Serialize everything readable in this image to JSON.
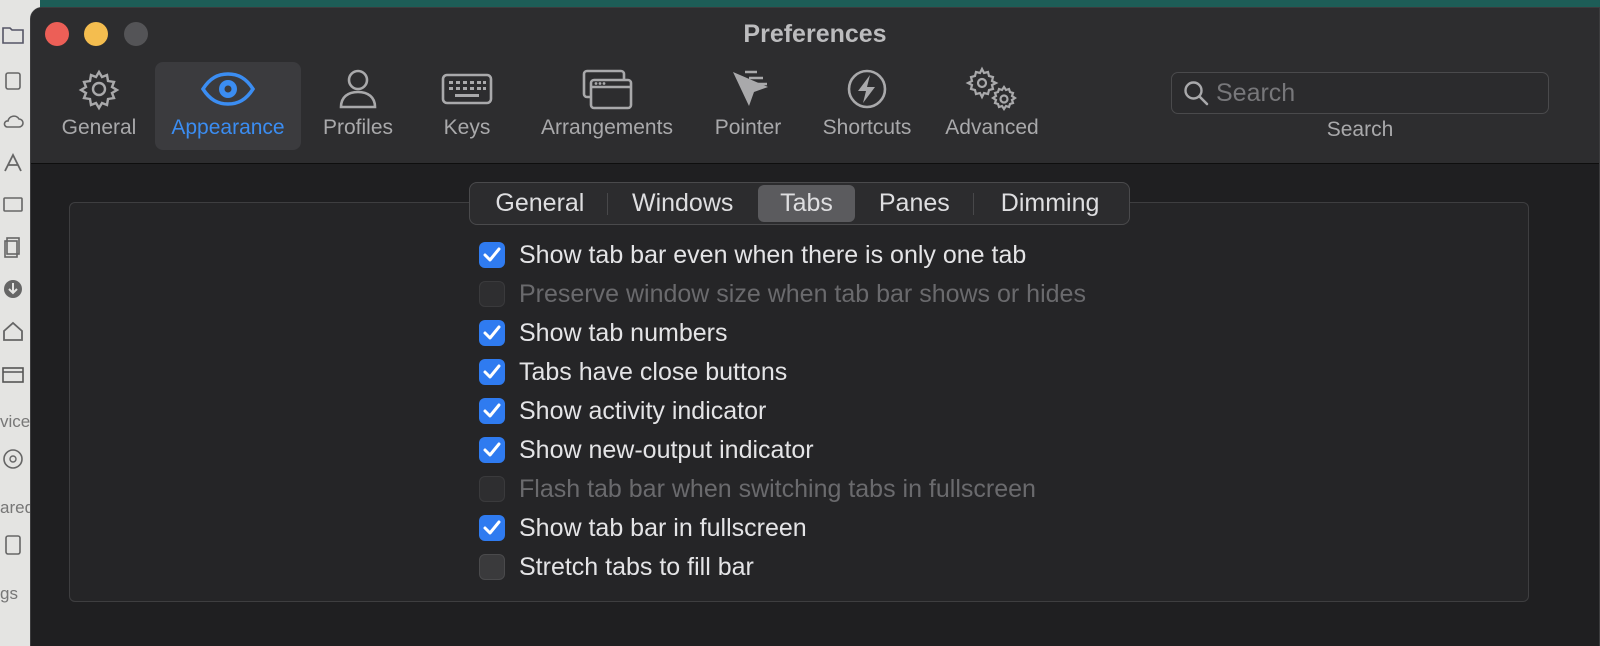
{
  "window": {
    "title": "Preferences"
  },
  "background": {
    "partial_texts": [
      "vice",
      "ared",
      "gs"
    ]
  },
  "toolbar": {
    "items": [
      {
        "label": "General",
        "icon": "gear-icon",
        "active": false
      },
      {
        "label": "Appearance",
        "icon": "eye-icon",
        "active": true
      },
      {
        "label": "Profiles",
        "icon": "person-icon",
        "active": false
      },
      {
        "label": "Keys",
        "icon": "keyboard-icon",
        "active": false
      },
      {
        "label": "Arrangements",
        "icon": "windows-icon",
        "active": false
      },
      {
        "label": "Pointer",
        "icon": "pointer-icon",
        "active": false
      },
      {
        "label": "Shortcuts",
        "icon": "lightning-icon",
        "active": false
      },
      {
        "label": "Advanced",
        "icon": "gears-icon",
        "active": false
      }
    ],
    "search": {
      "placeholder": "Search",
      "label": "Search"
    }
  },
  "subtabs": {
    "items": [
      "General",
      "Windows",
      "Tabs",
      "Panes",
      "Dimming"
    ],
    "selected": "Tabs"
  },
  "options": [
    {
      "label": "Show tab bar even when there is only one tab",
      "checked": true,
      "enabled": true
    },
    {
      "label": "Preserve window size when tab bar shows or hides",
      "checked": false,
      "enabled": false
    },
    {
      "label": "Show tab numbers",
      "checked": true,
      "enabled": true
    },
    {
      "label": "Tabs have close buttons",
      "checked": true,
      "enabled": true
    },
    {
      "label": "Show activity indicator",
      "checked": true,
      "enabled": true
    },
    {
      "label": "Show new-output indicator",
      "checked": true,
      "enabled": true
    },
    {
      "label": "Flash tab bar when switching tabs in fullscreen",
      "checked": false,
      "enabled": false
    },
    {
      "label": "Show tab bar in fullscreen",
      "checked": true,
      "enabled": true
    },
    {
      "label": "Stretch tabs to fill bar",
      "checked": false,
      "enabled": true
    }
  ],
  "colors": {
    "accent": "#2f7bf0",
    "active_toolbar_text": "#3b8df2",
    "window_bg": "#1f1f21",
    "titlebar_bg": "#2d2d2f",
    "close": "#ec5f57",
    "minimize": "#f4bd4f"
  }
}
